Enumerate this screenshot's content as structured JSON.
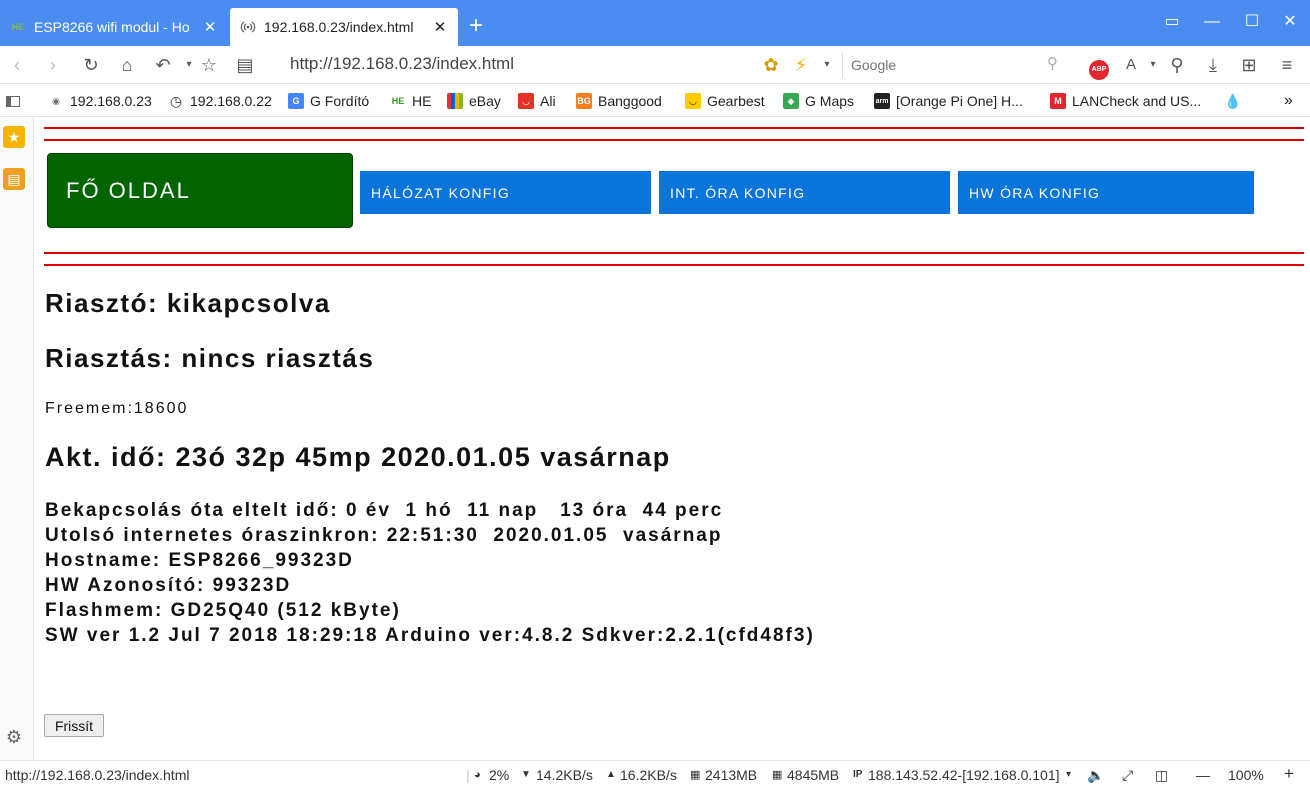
{
  "tabs": [
    {
      "title": "ESP8266 wifi modul - Ho",
      "favicon": "HE"
    },
    {
      "title": "192.168.0.23/index.html",
      "favicon": "wifi-icon"
    }
  ],
  "address": {
    "url": "http://192.168.0.23/index.html",
    "search_placeholder": "Google"
  },
  "bookmarks": [
    {
      "label": "192.168.0.23"
    },
    {
      "label": "192.168.0.22"
    },
    {
      "label": "G Fordító"
    },
    {
      "label": "HE",
      "icon_text": "HE"
    },
    {
      "label": "eBay"
    },
    {
      "label": "Ali"
    },
    {
      "label": "Banggood",
      "icon_text": "BG"
    },
    {
      "label": "Gearbest"
    },
    {
      "label": "G Maps"
    },
    {
      "label": "[Orange Pi One] H...",
      "icon_text": "arm"
    },
    {
      "label": "LANCheck and US..."
    }
  ],
  "page": {
    "nav": {
      "home": "FŐ OLDAL",
      "network": "HÁLÓZAT KONFIG",
      "int_clock": "INT. ÓRA KONFIG",
      "hw_clock": "HW ÓRA KONFIG"
    },
    "alarm_state": "Riasztó: kikapcsolva",
    "alarm_event": "Riasztás: nincs riasztás",
    "freemem": "Freemem:18600",
    "current_time": "Akt. idő: 23ó 32p 45mp  2020.01.05  vasárnap",
    "info_lines": [
      "Bekapcsolás óta eltelt idő: 0 év  1 hó  11 nap   13 óra  44 perc",
      "Utolsó internetes óraszinkron: 22:51:30  2020.01.05  vasárnap",
      "Hostname: ESP8266_99323D",
      "HW Azonosító: 99323D",
      "Flashmem: GD25Q40 (512 kByte)",
      "SW ver 1.2 Jul 7 2018 18:29:18 Arduino ver:4.8.2 Sdkver:2.2.1(cfd48f3)"
    ],
    "refresh_button": "Frissít"
  },
  "status": {
    "url": "http://192.168.0.23/index.html",
    "cpu": "2%",
    "down": "14.2KB/s",
    "up": "16.2KB/s",
    "mem1": "2413MB",
    "mem2": "4845MB",
    "ip": "188.143.52.42-[192.168.0.101]",
    "zoom": "100%"
  },
  "colors": {
    "home_button": "#006400",
    "nav_button": "#0a74db",
    "rule": "#e00000",
    "tabbar": "#4a8cf0"
  }
}
